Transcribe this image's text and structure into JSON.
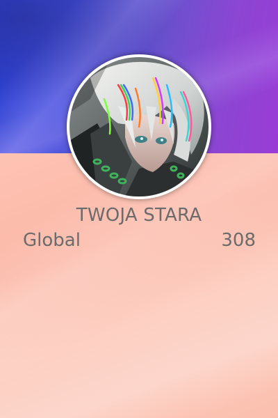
{
  "profile": {
    "username": "TWOJA STARA",
    "rank_label": "Global",
    "rank_value": "308"
  },
  "icons": {
    "avatar": "avatar-icon"
  },
  "colors": {
    "banner_start": "#2a3fd0",
    "banner_end": "#9a3cd6",
    "body_bg": "#fec3b4",
    "text": "#6b6b6b",
    "ring": "#ffffff"
  }
}
